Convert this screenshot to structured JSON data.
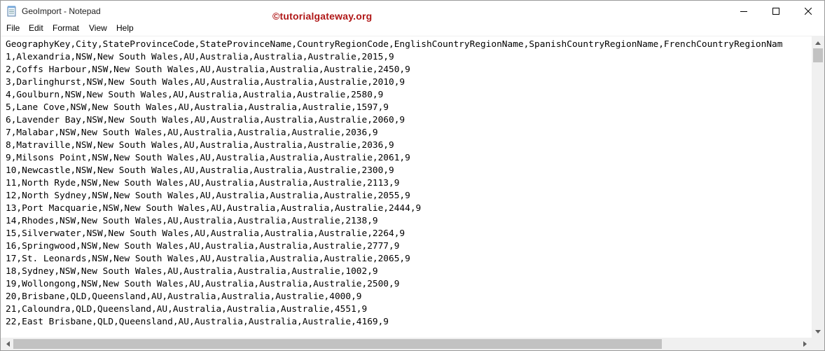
{
  "window": {
    "title": "GeoImport - Notepad",
    "watermark": "©tutorialgateway.org",
    "controls": {
      "minimize": "minimize",
      "maximize": "maximize",
      "close": "close"
    }
  },
  "menu": [
    "File",
    "Edit",
    "Format",
    "View",
    "Help"
  ],
  "editor": {
    "lines": [
      "GeographyKey,City,StateProvinceCode,StateProvinceName,CountryRegionCode,EnglishCountryRegionName,SpanishCountryRegionName,FrenchCountryRegionNam",
      "1,Alexandria,NSW,New South Wales,AU,Australia,Australia,Australie,2015,9",
      "2,Coffs Harbour,NSW,New South Wales,AU,Australia,Australia,Australie,2450,9",
      "3,Darlinghurst,NSW,New South Wales,AU,Australia,Australia,Australie,2010,9",
      "4,Goulburn,NSW,New South Wales,AU,Australia,Australia,Australie,2580,9",
      "5,Lane Cove,NSW,New South Wales,AU,Australia,Australia,Australie,1597,9",
      "6,Lavender Bay,NSW,New South Wales,AU,Australia,Australia,Australie,2060,9",
      "7,Malabar,NSW,New South Wales,AU,Australia,Australia,Australie,2036,9",
      "8,Matraville,NSW,New South Wales,AU,Australia,Australia,Australie,2036,9",
      "9,Milsons Point,NSW,New South Wales,AU,Australia,Australia,Australie,2061,9",
      "10,Newcastle,NSW,New South Wales,AU,Australia,Australia,Australie,2300,9",
      "11,North Ryde,NSW,New South Wales,AU,Australia,Australia,Australie,2113,9",
      "12,North Sydney,NSW,New South Wales,AU,Australia,Australia,Australie,2055,9",
      "13,Port Macquarie,NSW,New South Wales,AU,Australia,Australia,Australie,2444,9",
      "14,Rhodes,NSW,New South Wales,AU,Australia,Australia,Australie,2138,9",
      "15,Silverwater,NSW,New South Wales,AU,Australia,Australia,Australie,2264,9",
      "16,Springwood,NSW,New South Wales,AU,Australia,Australia,Australie,2777,9",
      "17,St. Leonards,NSW,New South Wales,AU,Australia,Australia,Australie,2065,9",
      "18,Sydney,NSW,New South Wales,AU,Australia,Australia,Australie,1002,9",
      "19,Wollongong,NSW,New South Wales,AU,Australia,Australia,Australie,2500,9",
      "20,Brisbane,QLD,Queensland,AU,Australia,Australia,Australie,4000,9",
      "21,Caloundra,QLD,Queensland,AU,Australia,Australia,Australie,4551,9",
      "22,East Brisbane,QLD,Queensland,AU,Australia,Australia,Australie,4169,9"
    ]
  },
  "colors": {
    "watermark": "#b01818",
    "scrollbar": "#f0f0f0",
    "thumb": "#c2c2c2"
  }
}
